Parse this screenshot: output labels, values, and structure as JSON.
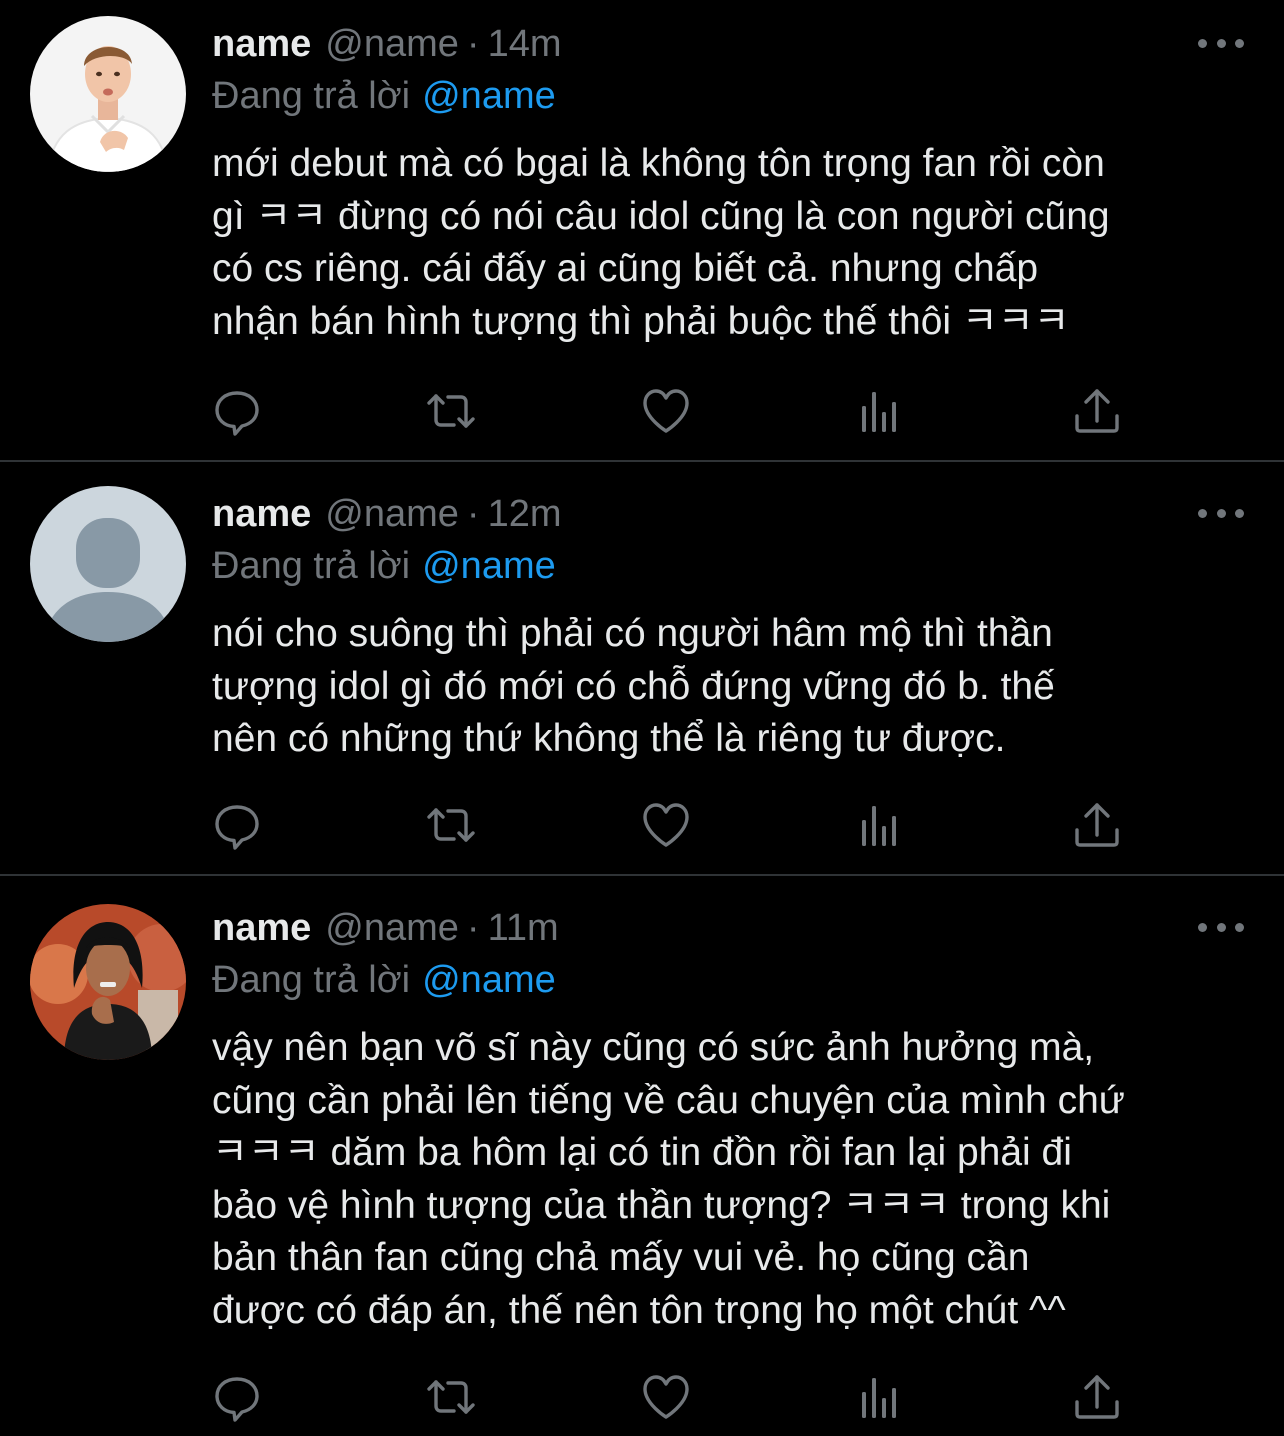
{
  "theme": {
    "background": "#000000",
    "text_primary": "#e7e9ea",
    "text_secondary": "#71767b",
    "accent": "#1d9bf0",
    "divider": "#2f3336"
  },
  "tweets": [
    {
      "avatar": "photo-avatar-man-white-shirt",
      "name": "name",
      "handle": "@name",
      "separator": "·",
      "time": "14m",
      "reply_prefix": "Đang trả lời",
      "reply_to": "@name",
      "text": "mới debut mà có bgai là không tôn trọng fan rồi còn\ngì ㅋㅋ đừng có nói câu idol cũng là con người cũng\ncó cs riêng. cái đấy ai cũng biết cả. nhưng chấp\nnhận bán hình tượng thì phải buộc thế thôi ㅋㅋㅋ"
    },
    {
      "avatar": "default-avatar-silhouette",
      "name": "name",
      "handle": "@name",
      "separator": "·",
      "time": "12m",
      "reply_prefix": "Đang trả lời",
      "reply_to": "@name",
      "text": "nói cho suông thì phải có người hâm mộ thì thần\ntượng idol gì đó mới có chỗ đứng vững đó b. thế\nnên có những thứ không thể là riêng tư được."
    },
    {
      "avatar": "photo-avatar-woman-dark-hair",
      "name": "name",
      "handle": "@name",
      "separator": "·",
      "time": "11m",
      "reply_prefix": "Đang trả lời",
      "reply_to": "@name",
      "text": "vậy nên bạn võ sĩ này cũng có sức ảnh hưởng mà,\ncũng cần phải lên tiếng về câu chuyện của mình chứ\nㅋㅋㅋ dăm ba hôm lại có tin đồn rồi fan lại phải đi\nbảo vệ hình tượng của thần tượng? ㅋㅋㅋ trong khi\nbản thân fan cũng chả mấy vui vẻ. họ cũng cần\nđược có đáp án, thế nên tôn trọng họ một chút ^^"
    }
  ],
  "action_icons": [
    "reply-icon",
    "retweet-icon",
    "like-icon",
    "analytics-icon",
    "share-icon"
  ]
}
